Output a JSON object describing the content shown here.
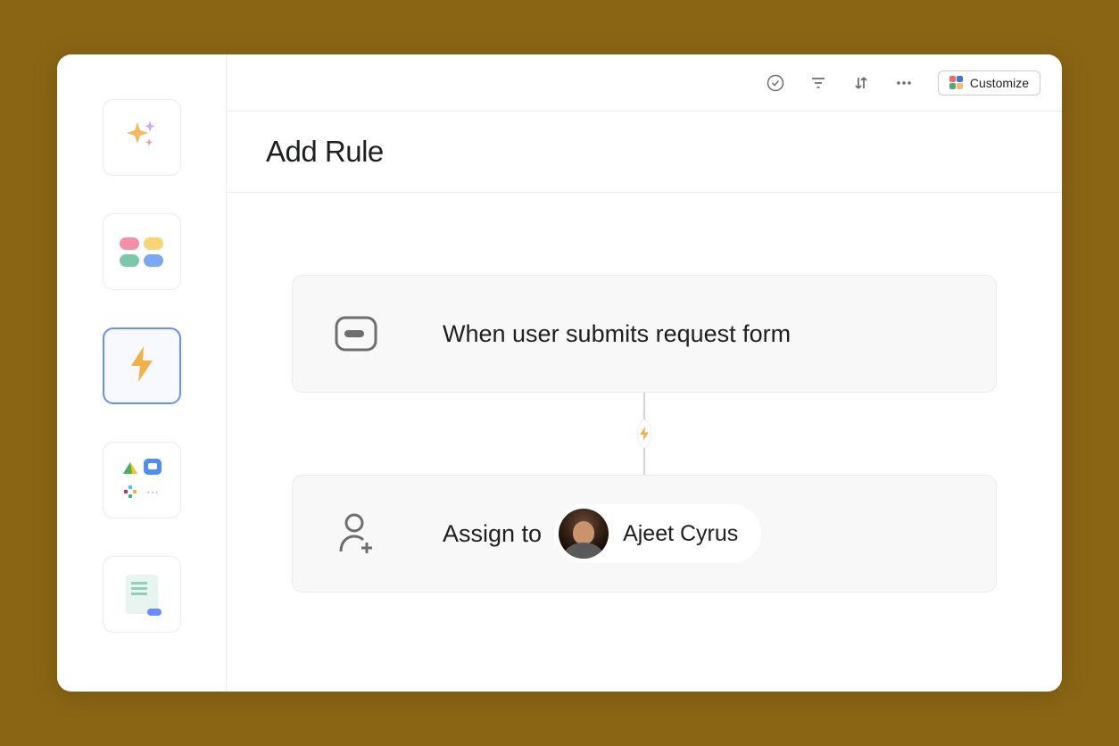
{
  "toolbar": {
    "customize_label": "Customize"
  },
  "page": {
    "title": "Add Rule"
  },
  "rule": {
    "trigger_text": "When user submits request form",
    "action_prefix": "Assign to",
    "assignee_name": "Ajeet Cyrus"
  },
  "sidebar": {
    "items": [
      {
        "name": "ai-sparkle"
      },
      {
        "name": "fields"
      },
      {
        "name": "rules"
      },
      {
        "name": "apps"
      },
      {
        "name": "forms"
      }
    ],
    "active_index": 2
  }
}
